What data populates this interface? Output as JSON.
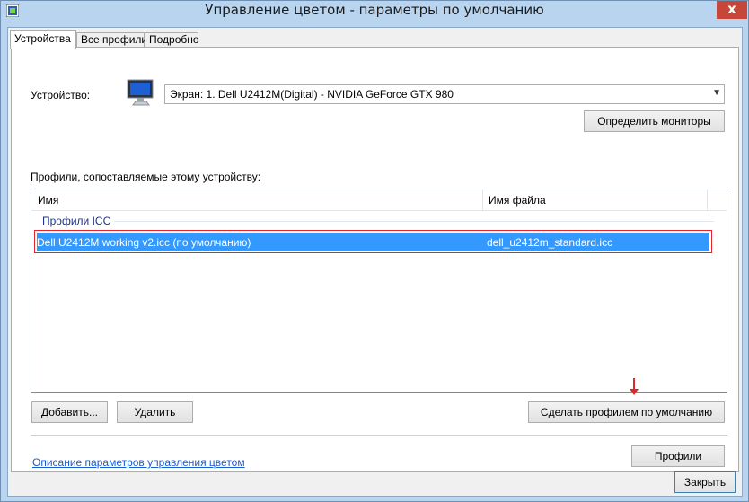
{
  "window": {
    "title": "Управление цветом - параметры по умолчанию",
    "close_glyph": "x"
  },
  "tabs": [
    {
      "label": "Устройства",
      "active": true
    },
    {
      "label": "Все профили",
      "active": false
    },
    {
      "label": "Подробно",
      "active": false
    }
  ],
  "device": {
    "label": "Устройство:",
    "selected": "Экран: 1. Dell U2412M(Digital) - NVIDIA GeForce GTX 980",
    "identify_button": "Определить мониторы"
  },
  "profiles": {
    "section_label": "Профили, сопоставляемые этому устройству:",
    "columns": [
      "Имя",
      "Имя файла"
    ],
    "group": "Профили ICC",
    "rows": [
      {
        "name": "Dell U2412M working v2.icc (по умолчанию)",
        "file": "dell_u2412m_standard.icc",
        "selected": true
      }
    ]
  },
  "actions": {
    "add": "Добавить...",
    "remove": "Удалить",
    "set_default": "Сделать профилем по умолчанию"
  },
  "footer": {
    "link": "Описание параметров управления цветом",
    "profiles_button": "Профили",
    "close_button": "Закрыть"
  },
  "colors": {
    "titlebar": "#b9d4ee",
    "selection": "#3399ff",
    "highlight_border": "#e3242b",
    "link": "#1a5ccf",
    "close": "#c7463a"
  }
}
